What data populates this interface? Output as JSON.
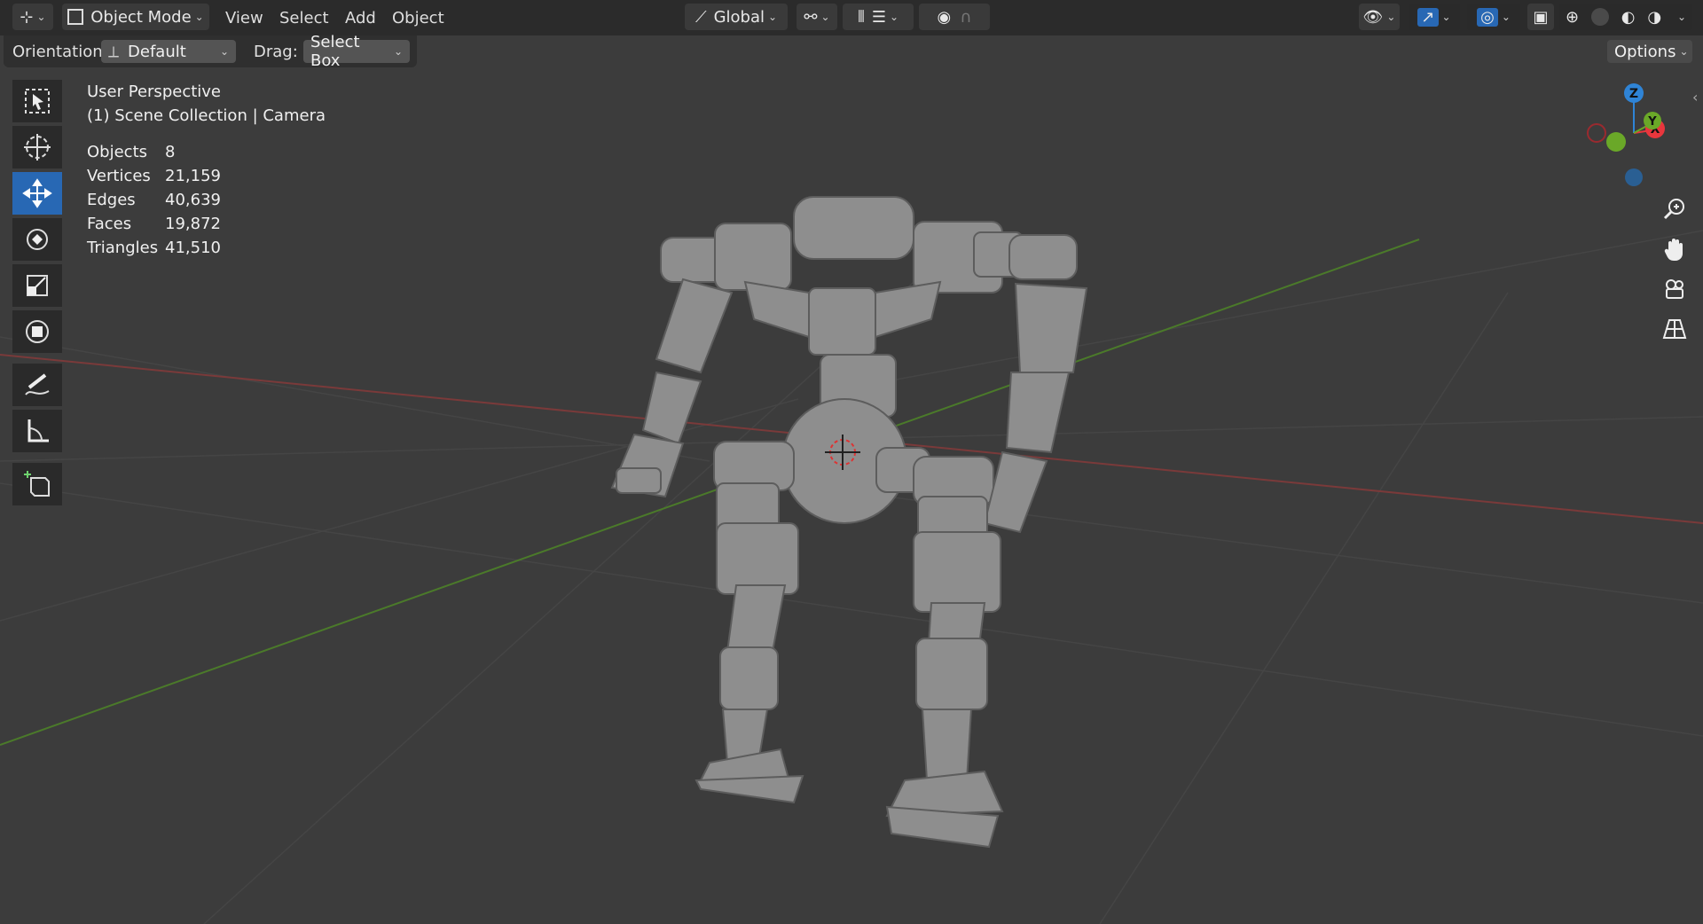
{
  "header": {
    "editor_type_icon": "axes-editor-icon",
    "mode_label": "Object Mode",
    "menus": [
      "View",
      "Select",
      "Add",
      "Object"
    ],
    "orientation_global": "Global",
    "icons": {
      "transform_pivot": "pivot-icon",
      "snap": "snap-icon",
      "proportional": "proportional-editing-icon",
      "visibility": "visibility-eye-icon",
      "gizmo": "gizmo-icon",
      "overlay": "overlay-icon",
      "xray": "xray-icon",
      "shading": [
        "wireframe-shading-icon",
        "solid-shading-icon",
        "material-shading-icon",
        "rendered-shading-icon"
      ]
    }
  },
  "tool_settings": {
    "orientation_label": "Orientation:",
    "orientation_value": "Default",
    "drag_label": "Drag:",
    "drag_value": "Select Box",
    "options_label": "Options"
  },
  "viewport_info": {
    "perspective": "User Perspective",
    "collection": "(1) Scene Collection | Camera"
  },
  "stats": [
    {
      "key": "Objects",
      "value": "8"
    },
    {
      "key": "Vertices",
      "value": "21,159"
    },
    {
      "key": "Edges",
      "value": "40,639"
    },
    {
      "key": "Faces",
      "value": "19,872"
    },
    {
      "key": "Triangles",
      "value": "41,510"
    }
  ],
  "tools": [
    {
      "name": "select-box-tool",
      "icon": "select-box-icon",
      "active": false
    },
    {
      "name": "cursor-tool",
      "icon": "cursor-icon",
      "active": false
    },
    {
      "name": "move-tool",
      "icon": "move-icon",
      "active": true
    },
    {
      "name": "rotate-tool",
      "icon": "rotate-icon",
      "active": false
    },
    {
      "name": "scale-tool",
      "icon": "scale-icon",
      "active": false
    },
    {
      "name": "transform-tool",
      "icon": "transform-icon",
      "active": false
    },
    {
      "name": "annotate-tool",
      "icon": "annotate-icon",
      "active": false
    },
    {
      "name": "measure-tool",
      "icon": "measure-icon",
      "active": false
    },
    {
      "name": "add-cube-tool",
      "icon": "add-cube-icon",
      "active": false
    }
  ],
  "gizmo": {
    "z": "Z",
    "y": "Y",
    "x": "X"
  },
  "colors": {
    "accent": "#2868b4",
    "axis_x": "#e8363d",
    "axis_y": "#6aa828",
    "axis_z": "#2f84d6",
    "viewport_bg": "#3c3c3c"
  }
}
